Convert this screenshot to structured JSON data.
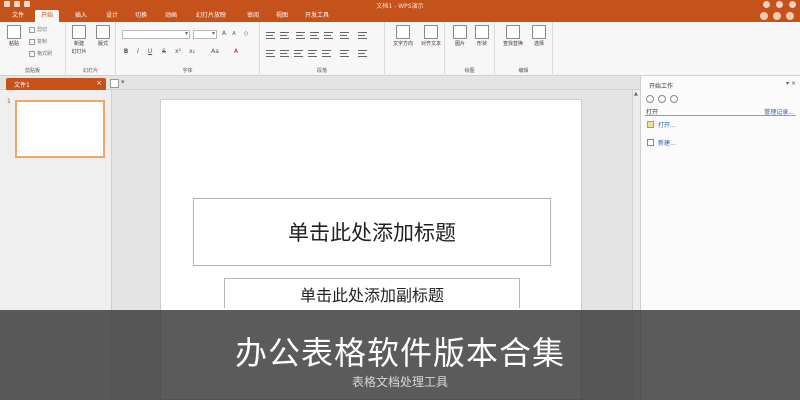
{
  "app": {
    "window_title": "文档1 - WPS演示"
  },
  "ribbon_tabs": [
    "文件",
    "开始",
    "插入",
    "设计",
    "切换",
    "动画",
    "幻灯片放映",
    "审阅",
    "视图",
    "开发工具"
  ],
  "active_tab_index": 1,
  "ribbon": {
    "clipboard": {
      "paste": "粘贴",
      "cut": "剪切",
      "copy": "复制",
      "format_painter": "格式刷",
      "group_label": "剪贴板"
    },
    "slides": {
      "new_slide_line1": "新建",
      "new_slide_line2": "幻灯片",
      "layout": "版式",
      "group_label": "幻灯片"
    },
    "font": {
      "group_label": "字体",
      "bold": "B",
      "italic": "I",
      "underline": "U",
      "strike": "S",
      "grow": "A",
      "shrink": "A",
      "clear": "Aa",
      "color": "A"
    },
    "paragraph": {
      "group_label": "段落"
    },
    "text_direction": "文字方向",
    "align_text": "对齐文本",
    "drawing": {
      "picture": "图片",
      "shapes": "形状",
      "group_label": "绘图"
    },
    "editing": {
      "find_replace": "查找替换",
      "select": "选择",
      "group_label": "编辑"
    }
  },
  "document_tab": {
    "name": "文件1"
  },
  "thumbnails": {
    "slide_number": "1"
  },
  "slide": {
    "title_placeholder": "单击此处添加标题",
    "subtitle_placeholder": "单击此处添加副标题"
  },
  "task_pane": {
    "title": "开始工作",
    "controls": "▾ ×",
    "section": "打开",
    "manage": "管理记录...",
    "open_link": "打开...",
    "new_link": "新建..."
  },
  "banner": {
    "title": "办公表格软件版本合集",
    "subtitle": "表格文档处理工具"
  },
  "colors": {
    "accent": "#c6521b",
    "thumb_border": "#f0a565",
    "link": "#2a5db0"
  }
}
